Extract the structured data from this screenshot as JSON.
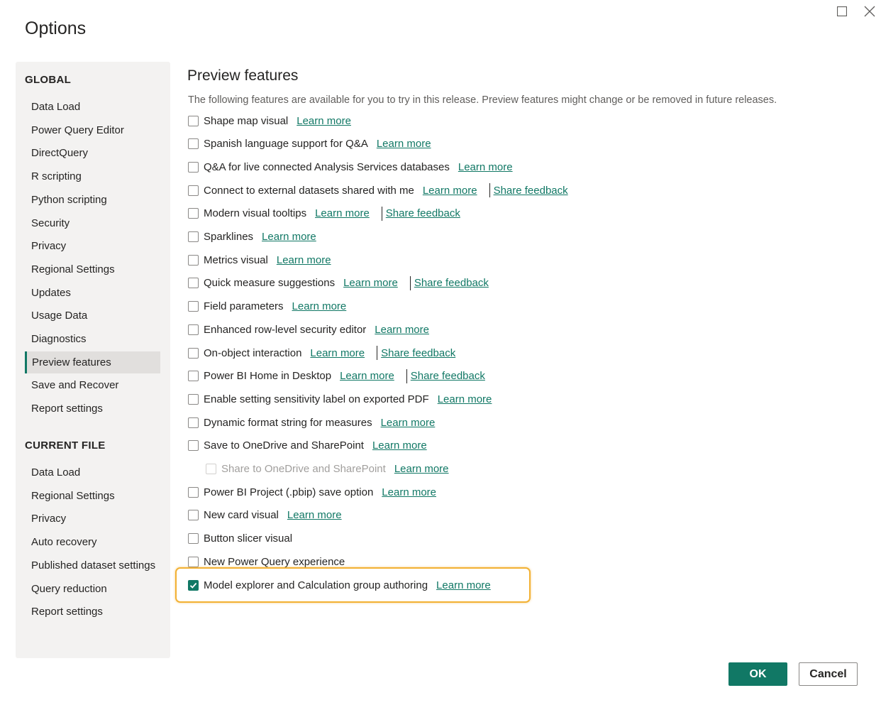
{
  "window": {
    "title": "Options",
    "maximize_icon": "maximize-icon",
    "close_icon": "close-icon"
  },
  "sidebar": {
    "global_header": "GLOBAL",
    "global_items": [
      "Data Load",
      "Power Query Editor",
      "DirectQuery",
      "R scripting",
      "Python scripting",
      "Security",
      "Privacy",
      "Regional Settings",
      "Updates",
      "Usage Data",
      "Diagnostics",
      "Preview features",
      "Save and Recover",
      "Report settings"
    ],
    "current_header": "CURRENT FILE",
    "current_items": [
      "Data Load",
      "Regional Settings",
      "Privacy",
      "Auto recovery",
      "Published dataset settings",
      "Query reduction",
      "Report settings"
    ],
    "selected": "Preview features"
  },
  "main": {
    "title": "Preview features",
    "description": "The following features are available for you to try in this release. Preview features might change or be removed in future releases.",
    "features": [
      {
        "label": "Shape map visual",
        "checked": false,
        "learn_more": "Learn more"
      },
      {
        "label": "Spanish language support for Q&A",
        "checked": false,
        "learn_more": "Learn more"
      },
      {
        "label": "Q&A for live connected Analysis Services databases",
        "checked": false,
        "learn_more": "Learn more"
      },
      {
        "label": "Connect to external datasets shared with me",
        "checked": false,
        "learn_more": "Learn more",
        "feedback": "Share feedback"
      },
      {
        "label": "Modern visual tooltips",
        "checked": false,
        "learn_more": "Learn more",
        "feedback": "Share feedback"
      },
      {
        "label": "Sparklines",
        "checked": false,
        "learn_more": "Learn more"
      },
      {
        "label": "Metrics visual",
        "checked": false,
        "learn_more": "Learn more"
      },
      {
        "label": "Quick measure suggestions",
        "checked": false,
        "learn_more": "Learn more",
        "feedback": "Share feedback"
      },
      {
        "label": "Field parameters",
        "checked": false,
        "learn_more": "Learn more"
      },
      {
        "label": "Enhanced row-level security editor",
        "checked": false,
        "learn_more": "Learn more"
      },
      {
        "label": "On-object interaction",
        "checked": false,
        "learn_more": "Learn more",
        "feedback": "Share feedback"
      },
      {
        "label": "Power BI Home in Desktop",
        "checked": false,
        "learn_more": "Learn more",
        "feedback": "Share feedback"
      },
      {
        "label": "Enable setting sensitivity label on exported PDF",
        "checked": false,
        "learn_more": "Learn more"
      },
      {
        "label": "Dynamic format string for measures",
        "checked": false,
        "learn_more": "Learn more"
      },
      {
        "label": "Save to OneDrive and SharePoint",
        "checked": false,
        "learn_more": "Learn more"
      },
      {
        "label": "Share to OneDrive and SharePoint",
        "checked": false,
        "disabled": true,
        "indent": true,
        "learn_more": "Learn more"
      },
      {
        "label": "Power BI Project (.pbip) save option",
        "checked": false,
        "learn_more": "Learn more"
      },
      {
        "label": "New card visual",
        "checked": false,
        "learn_more": "Learn more"
      },
      {
        "label": "Button slicer visual",
        "checked": false
      },
      {
        "label": "New Power Query experience",
        "checked": false
      },
      {
        "label": "Model explorer and Calculation group authoring",
        "checked": true,
        "learn_more": "Learn more",
        "highlighted": true
      }
    ]
  },
  "footer": {
    "ok_label": "OK",
    "cancel_label": "Cancel"
  },
  "colors": {
    "accent": "#117865",
    "highlight": "#f2b134",
    "sidebar_bg": "#f3f2f1",
    "selected_bg": "#e1dfdd"
  }
}
